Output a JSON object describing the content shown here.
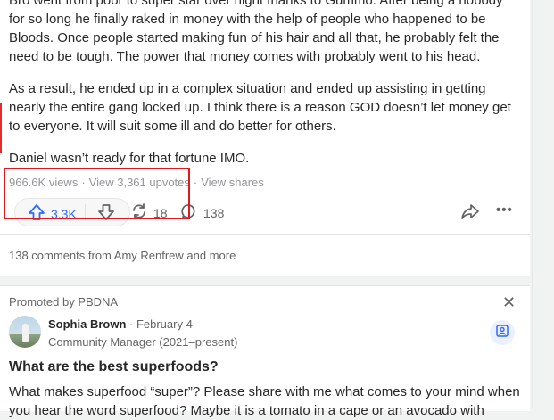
{
  "answer": {
    "paragraph_1": "Bro went from poor to super star over night thanks to Gummo. After being a nobody for so long he finally raked in money with the help of people who happened to be Bloods. Once people started making fun of his hair and all that, he probably felt the need to be tough. The power that money comes with probably went to his head.",
    "paragraph_2": "As a result, he ended up in a complex situation and ended up assisting in getting nearly the entire gang locked up. I think there is a reason GOD doesn’t let money get to everyone. It will suit some ill and do better for others.",
    "paragraph_3": "Daniel wasn’t ready for that fortune IMO."
  },
  "stats": {
    "views": "966.6K views",
    "separator": "·",
    "upvotes_link": "View 3,361 upvotes",
    "shares_link": "View shares"
  },
  "actions": {
    "upvote_count": "3.3K",
    "share_count": "18",
    "comment_count": "138"
  },
  "comments_summary": "138 comments from Amy Renfrew and more",
  "promo": {
    "promoted_by": "Promoted by PBDNA",
    "author_name": "Sophia Brown",
    "date": "· February 4",
    "role": "Community Manager (2021–present)",
    "title": "What are the best superfoods?",
    "body": "What makes superfood “super”? Please share with me what comes to your mind when you hear the word superfood? Maybe it is a tomato in a cape or an avocado with"
  },
  "colors": {
    "accent": "#2e69ff",
    "highlight": "#e0191f"
  }
}
